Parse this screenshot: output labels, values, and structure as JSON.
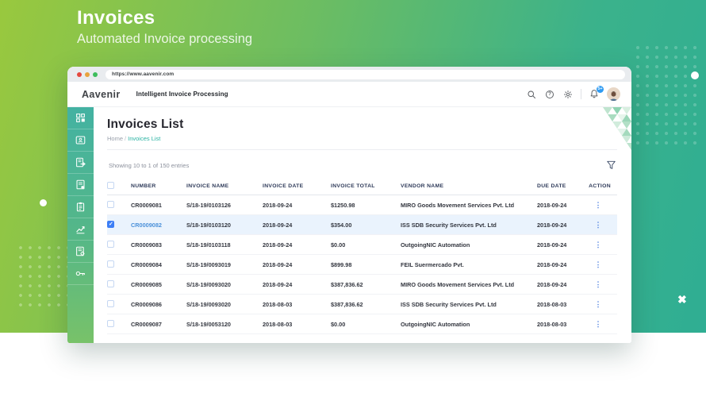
{
  "banner": {
    "title": "Invoices",
    "subtitle": "Automated Invoice processing"
  },
  "browser": {
    "url": "https://www.aavenir.com"
  },
  "header": {
    "logo": "Aavenir",
    "app_title": "Intelligent Invoice Processing",
    "notification_count": "5+",
    "icons": [
      "search-icon",
      "help-icon",
      "gear-icon",
      "bell-icon",
      "avatar"
    ]
  },
  "sidebar": {
    "icons": [
      "dashboard-icon",
      "vendor-card-icon",
      "invoice-outbox-icon",
      "invoice-note-icon",
      "clipboard-icon",
      "analytics-icon",
      "report-settings-icon",
      "key-icon"
    ]
  },
  "page": {
    "title": "Invoices List",
    "breadcrumb_home": "Home",
    "breadcrumb_sep": "/",
    "breadcrumb_current": "Invoices List",
    "showing_text": "Showing 10 to 1 of 150 entries"
  },
  "table": {
    "columns": [
      "NUMBER",
      "INVOICE NAME",
      "INVOICE DATE",
      "INVOICE TOTAL",
      "VENDOR NAME",
      "DUE DATE",
      "ACTION"
    ],
    "rows": [
      {
        "number": "CR0009081",
        "invoice_name": "S/18-19/0103126",
        "invoice_date": "2018-09-24",
        "invoice_total": "$1250.98",
        "vendor_name": "MIRO Goods Movement Services Pvt. Ltd",
        "due_date": "2018-09-24",
        "selected": false
      },
      {
        "number": "CR0009082",
        "invoice_name": "S/18-19/0103120",
        "invoice_date": "2018-09-24",
        "invoice_total": "$354.00",
        "vendor_name": "ISS SDB Security Services Pvt. Ltd",
        "due_date": "2018-09-24",
        "selected": true
      },
      {
        "number": "CR0009083",
        "invoice_name": "S/18-19/0103118",
        "invoice_date": "2018-09-24",
        "invoice_total": "$0.00",
        "vendor_name": "OutgoingNIC Automation",
        "due_date": "2018-09-24",
        "selected": false
      },
      {
        "number": "CR0009084",
        "invoice_name": "S/18-19/0093019",
        "invoice_date": "2018-09-24",
        "invoice_total": "$899.98",
        "vendor_name": "FEIL Suermercado Pvt.",
        "due_date": "2018-09-24",
        "selected": false
      },
      {
        "number": "CR0009085",
        "invoice_name": "S/18-19/0093020",
        "invoice_date": "2018-09-24",
        "invoice_total": "$387,836.62",
        "vendor_name": "MIRO Goods Movement Services Pvt. Ltd",
        "due_date": "2018-09-24",
        "selected": false
      },
      {
        "number": "CR0009086",
        "invoice_name": "S/18-19/0093020",
        "invoice_date": "2018-08-03",
        "invoice_total": "$387,836.62",
        "vendor_name": "ISS SDB Security Services Pvt. Ltd",
        "due_date": "2018-08-03",
        "selected": false
      },
      {
        "number": "CR0009087",
        "invoice_name": "S/18-19/0053120",
        "invoice_date": "2018-08-03",
        "invoice_total": "$0.00",
        "vendor_name": "OutgoingNIC Automation",
        "due_date": "2018-08-03",
        "selected": false
      }
    ]
  },
  "colors": {
    "banner_green": "#99c83e",
    "banner_teal": "#2fae93",
    "sidebar_top": "#43b2a2",
    "sidebar_bottom": "#78c269",
    "accent_teal": "#2bb3a3",
    "selected_row_bg": "#eaf3fd",
    "selected_blue": "#3d7ef5",
    "badge_blue": "#2f9bf2",
    "header_text": "#2e3a59"
  }
}
